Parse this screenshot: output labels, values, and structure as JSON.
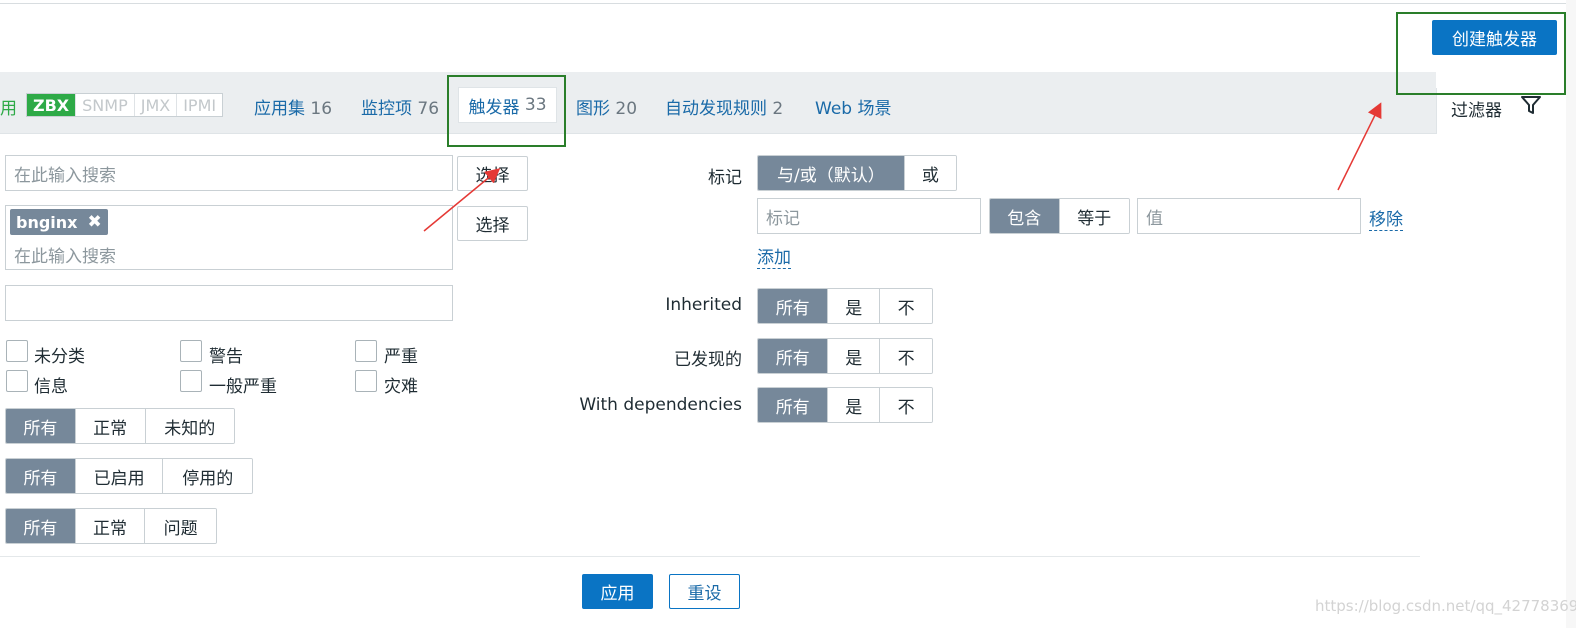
{
  "header": {
    "create_trigger_label": "创建触发器"
  },
  "tabs": {
    "partial_left": "用",
    "interfaces": [
      "ZBX",
      "SNMP",
      "JMX",
      "IPMI"
    ],
    "applications": {
      "label": "应用集",
      "count": "16"
    },
    "items": {
      "label": "监控项",
      "count": "76"
    },
    "triggers": {
      "label": "触发器",
      "count": "33"
    },
    "graphs": {
      "label": "图形",
      "count": "20"
    },
    "discovery": {
      "label": "自动发现规则",
      "count": "2"
    },
    "web": {
      "label": "Web 场景"
    },
    "filter": "过滤器"
  },
  "filter": {
    "host_group_placeholder": "在此输入搜索",
    "select_label": "选择",
    "host_tag": "bnginx",
    "host_placeholder": "在此输入搜索",
    "name_value": "",
    "severities": [
      "未分类",
      "警告",
      "严重",
      "信息",
      "一般严重",
      "灾难"
    ],
    "state_options": [
      "所有",
      "正常",
      "未知的"
    ],
    "status_options": [
      "所有",
      "已启用",
      "停用的"
    ],
    "value_options": [
      "所有",
      "正常",
      "问题"
    ],
    "tags_label": "标记",
    "tags_mode": [
      "与/或（默认）",
      "或"
    ],
    "tag_name_placeholder": "标记",
    "tag_operator": [
      "包含",
      "等于"
    ],
    "tag_value_placeholder": "值",
    "remove_label": "移除",
    "add_label": "添加",
    "inherited_label": "Inherited",
    "discovered_label": "已发现的",
    "dependencies_label": "With dependencies",
    "tri_options": [
      "所有",
      "是",
      "不"
    ],
    "apply_label": "应用",
    "reset_label": "重设"
  },
  "watermark": "https://blog.csdn.net/qq_42778369"
}
